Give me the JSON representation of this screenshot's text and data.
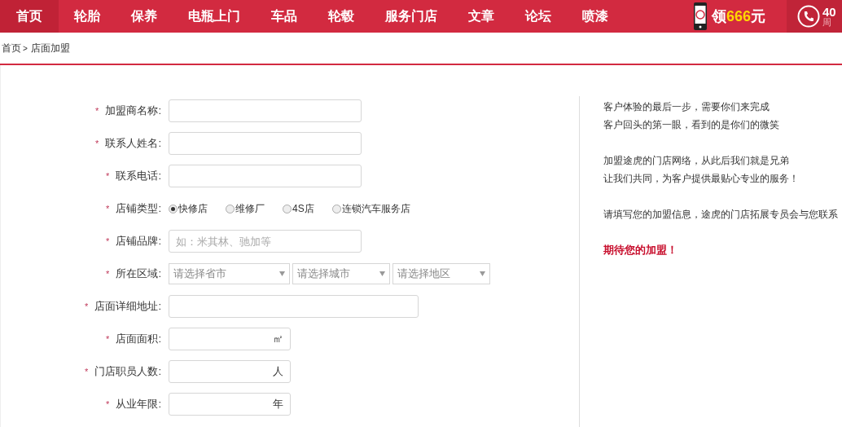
{
  "nav": {
    "items": [
      {
        "label": "首页",
        "selected": true
      },
      {
        "label": "轮胎",
        "selected": false
      },
      {
        "label": "保养",
        "selected": false
      },
      {
        "label": "电瓶上门",
        "selected": false
      },
      {
        "label": "车品",
        "selected": false
      },
      {
        "label": "轮毂",
        "selected": false
      },
      {
        "label": "服务门店",
        "selected": false
      },
      {
        "label": "文章",
        "selected": false
      },
      {
        "label": "论坛",
        "selected": false
      },
      {
        "label": "喷漆",
        "selected": false
      }
    ],
    "promo": {
      "prefix": "领",
      "amount": "666",
      "suffix": "元"
    },
    "hotline": {
      "number": "40",
      "hours": "周"
    }
  },
  "breadcrumb": {
    "home": "首页",
    "separator": ">",
    "current": "店面加盟"
  },
  "form": {
    "fields": [
      {
        "kind": "text",
        "label": "加盟商名称:",
        "marker": "*"
      },
      {
        "kind": "text",
        "label": "联系人姓名:",
        "marker": "*"
      },
      {
        "kind": "text",
        "label": "联系电话:",
        "marker": "*"
      },
      {
        "kind": "radio",
        "label": "店铺类型:",
        "marker": "*",
        "options": [
          {
            "label": "快修店",
            "selected": true
          },
          {
            "label": "维修厂",
            "selected": false
          },
          {
            "label": "4S店",
            "selected": false
          },
          {
            "label": "连锁汽车服务店",
            "selected": false
          }
        ]
      },
      {
        "kind": "text",
        "label": "店铺品牌:",
        "marker": "*",
        "placeholder": "如：米其林、驰加等"
      },
      {
        "kind": "select",
        "label": "所在区域:",
        "marker": "*",
        "selects": [
          "请选择省市",
          "请选择城市",
          "请选择地区"
        ]
      },
      {
        "kind": "wide",
        "label": "店面详细地址:",
        "marker": "*"
      },
      {
        "kind": "unit",
        "label": "店面面积:",
        "marker": "*",
        "unit": "㎡"
      },
      {
        "kind": "unit",
        "label": "门店职员人数:",
        "marker": "*",
        "unit": "人"
      },
      {
        "kind": "unit",
        "label": "从业年限:",
        "marker": "*",
        "unit": "年"
      }
    ]
  },
  "aside": {
    "paragraphs": [
      {
        "kind": "plain",
        "lines": [
          "客户体验的最后一步，需要你们来完成",
          "客户回头的第一眼，看到的是你们的微笑"
        ]
      },
      {
        "kind": "plain",
        "lines": [
          "加盟途虎的门店网络，从此后我们就是兄弟",
          "让我们共同，为客户提供最贴心专业的服务！"
        ]
      },
      {
        "kind": "plain",
        "lines": [
          "请填写您的加盟信息，途虎的门店拓展专员会与您联系"
        ]
      },
      {
        "kind": "emphasis",
        "lines": [
          "期待您的加盟！"
        ]
      }
    ]
  }
}
